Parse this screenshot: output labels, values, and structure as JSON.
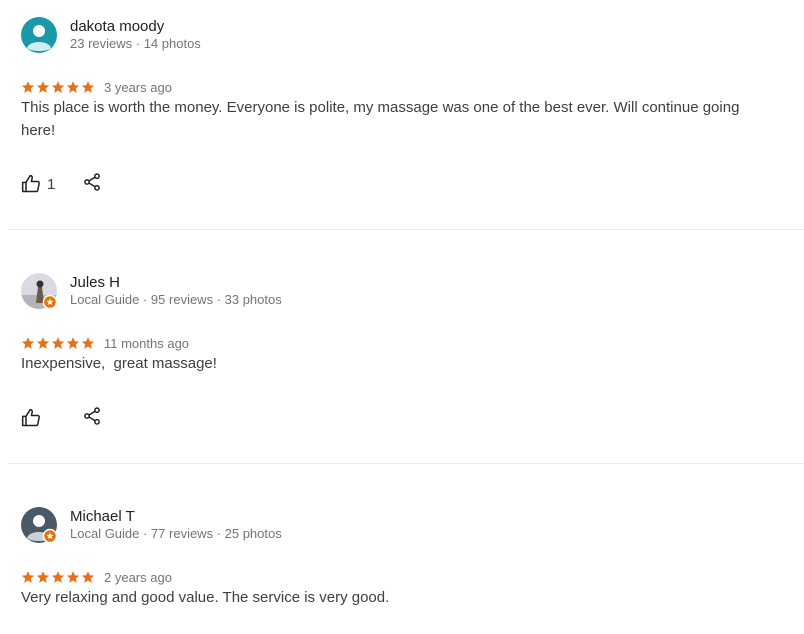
{
  "reviews": [
    {
      "name": "dakota moody",
      "meta": "23 reviews · 14 photos",
      "rating": 5,
      "date": "3 years ago",
      "text": "This place is worth the money. Everyone is polite, my massage was one of the best ever. Will continue going here!",
      "likes": "1",
      "avatar_icon": "default-person-avatar-icon",
      "avatar_color": "#1a9aa8"
    },
    {
      "name": "Jules H",
      "meta": "Local Guide · 95 reviews · 33 photos",
      "rating": 5,
      "date": "11 months ago",
      "text": "Inexpensive,  great massage!",
      "likes": "",
      "avatar_icon": "photo-avatar-icon",
      "local_guide_badge": true
    },
    {
      "name": "Michael T",
      "meta": "Local Guide · 77 reviews · 25 photos",
      "rating": 5,
      "date": "2 years ago",
      "text": "Very relaxing and good value. The service is very good.",
      "likes": "",
      "avatar_icon": "default-person-avatar-icon",
      "avatar_color": "#4a5965",
      "local_guide_badge": true
    }
  ],
  "colors": {
    "star": "#e7711b",
    "secondary_text": "#70757a",
    "badge": "#e8710a",
    "divider": "#e8eaed"
  }
}
